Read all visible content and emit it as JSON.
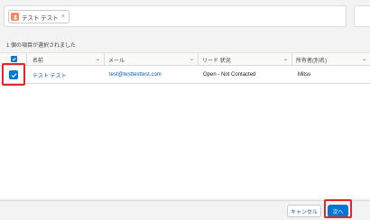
{
  "search": {
    "pill_label": "テスト テスト",
    "pill_close": "×"
  },
  "selection": {
    "count_text": "1 個の項目が選択されました"
  },
  "table": {
    "columns": [
      {
        "label": "名前"
      },
      {
        "label": "メール"
      },
      {
        "label": "リード 状況"
      },
      {
        "label": "所有者(別名)"
      }
    ],
    "rows": [
      {
        "name": "テスト テスト",
        "email": "test@testtesttest.com",
        "status": "Open - Not Contacted",
        "owner": "Mitsu",
        "selected": true
      }
    ]
  },
  "footer": {
    "cancel_label": "キャンセル",
    "next_label": "次へ"
  },
  "colors": {
    "accent": "#0176d3",
    "highlight": "#e3262a",
    "lead_icon": "#f88962"
  }
}
